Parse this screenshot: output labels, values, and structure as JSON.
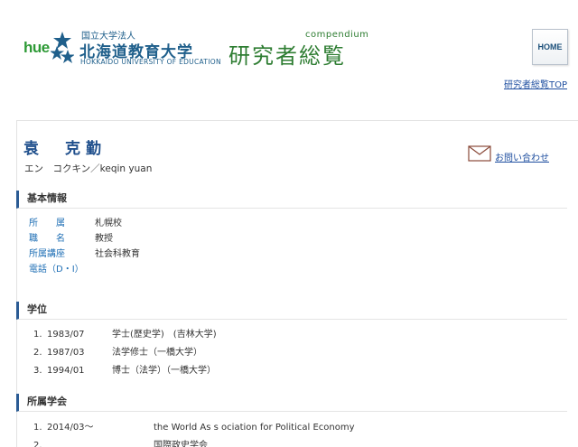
{
  "header": {
    "logo_text": "hue",
    "univ_legal": "国立大学法人",
    "univ_name": "北海道教育大学",
    "univ_en": "HOKKAIDO UNIVERSITY OF EDUCATION",
    "compendium": "compendium",
    "site_title": "研究者総覧",
    "home_label": "HOME",
    "top_link": "研究者総覧TOP"
  },
  "colors": {
    "brand_green": "#2e7d32",
    "brand_blue": "#1f5f8b",
    "link": "#1f4fa0",
    "section_bar": "#2b5b94"
  },
  "profile": {
    "name": "袁　克勤",
    "kana": "エン　コクキン／keqin yuan",
    "contact_icon": "envelope-icon",
    "contact_label": "お問い合わせ"
  },
  "basic_info": {
    "title": "基本情報",
    "rows": [
      {
        "label": "所　　属",
        "value": "札幌校"
      },
      {
        "label": "職　　名",
        "value": "教授"
      },
      {
        "label": "所属講座",
        "value": "社会科教育"
      },
      {
        "label": "電話（D・I）",
        "value": ""
      }
    ]
  },
  "degrees": {
    "title": "学位",
    "rows": [
      {
        "no": "1.",
        "date": "1983/07",
        "value": "学士(歴史学)　(吉林大学)"
      },
      {
        "no": "2.",
        "date": "1987/03",
        "value": "法学修士（一橋大学）"
      },
      {
        "no": "3.",
        "date": "1994/01",
        "value": "博士（法学）（一橋大学）"
      }
    ]
  },
  "societies": {
    "title": "所属学会",
    "rows": [
      {
        "no": "1.",
        "date": "2014/03～",
        "value": "the World As s ociation for Political Economy"
      },
      {
        "no": "2.",
        "date": "",
        "value": "国際政史学会"
      }
    ]
  }
}
